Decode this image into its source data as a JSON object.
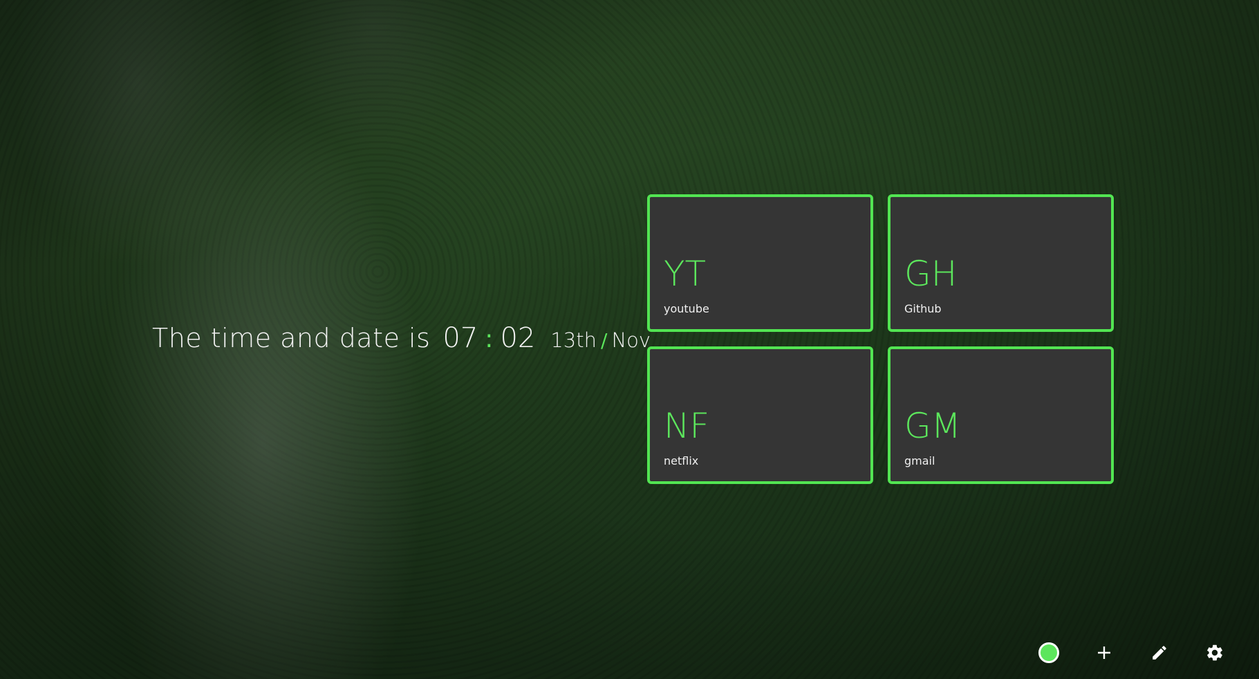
{
  "clock": {
    "lead": "The time and date is",
    "hour": "07",
    "separator": ":",
    "minute": "02",
    "day": "13th",
    "date_separator": "/",
    "month": "Nov"
  },
  "shortcuts": [
    {
      "abbr": "YT",
      "name": "youtube"
    },
    {
      "abbr": "GH",
      "name": "Github"
    },
    {
      "abbr": "NF",
      "name": "netflix"
    },
    {
      "abbr": "GM",
      "name": "gmail"
    }
  ],
  "toolbar": {
    "theme_color": "#5ce65c",
    "icons": [
      "color-dot-icon",
      "plus-icon",
      "pencil-icon",
      "gear-icon"
    ]
  },
  "colors": {
    "accent": "#5ce65c",
    "tile_background": "#353535",
    "text": "#f2f2f2"
  }
}
